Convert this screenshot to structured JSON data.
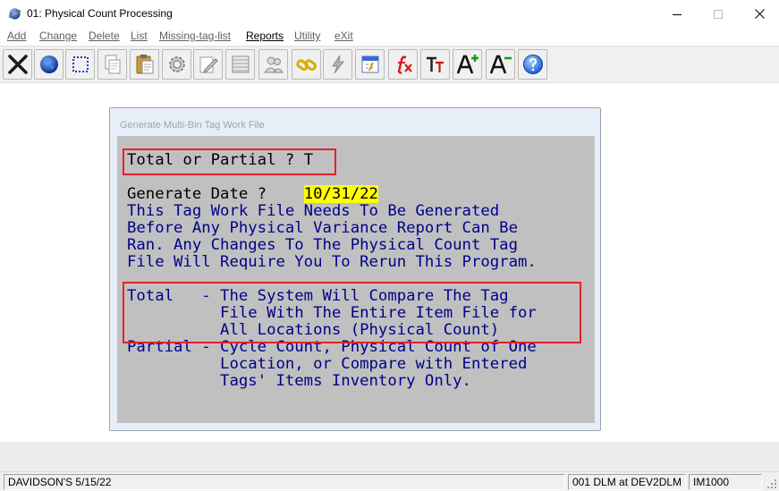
{
  "window": {
    "title": "01: Physical Count Processing"
  },
  "menu": [
    {
      "label": "Add"
    },
    {
      "label": "Change"
    },
    {
      "label": "Delete"
    },
    {
      "label": "List"
    },
    {
      "label": "Missing-tag-list"
    },
    {
      "label": "Reports"
    },
    {
      "label": "Utility"
    },
    {
      "label": "eXit"
    }
  ],
  "toolbar": [
    {
      "icon": "exit-icon"
    },
    {
      "icon": "globe-icon"
    },
    {
      "icon": "select-icon"
    },
    {
      "icon": "copy-icon"
    },
    {
      "icon": "paste-icon"
    },
    {
      "icon": "gear-icon"
    },
    {
      "icon": "edit-icon"
    },
    {
      "icon": "list-icon"
    },
    {
      "icon": "users-icon"
    },
    {
      "icon": "link-icon"
    },
    {
      "icon": "lightning-icon"
    },
    {
      "icon": "calendar-icon"
    },
    {
      "icon": "function-icon"
    },
    {
      "icon": "text-size-icon"
    },
    {
      "icon": "font-increase-icon"
    },
    {
      "icon": "font-decrease-icon"
    },
    {
      "icon": "help-icon"
    }
  ],
  "dialog": {
    "title": "Generate Multi-Bin Tag Work File",
    "prompt_label": "Total or Partial ? ",
    "prompt_value": "T",
    "date_label": "Generate Date ?    ",
    "date_value": "10/31/22",
    "info_lines": [
      "This Tag Work File Needs To Be Generated",
      "Before Any Physical Variance Report Can Be",
      "Ran. Any Changes To The Physical Count Tag",
      "File Will Require You To Rerun This Program."
    ],
    "total_lines": [
      "Total   - The System Will Compare The Tag",
      "          File With The Entire Item File for",
      "          All Locations (Physical Count)"
    ],
    "partial_lines": [
      "Partial - Cycle Count, Physical Count of One",
      "          Location, or Compare with Entered",
      "          Tags' Items Inventory Only."
    ]
  },
  "status": {
    "left": "DAVIDSON'S 5/15/22",
    "center": "001 DLM at DEV2DLM",
    "right": "IM1000"
  }
}
